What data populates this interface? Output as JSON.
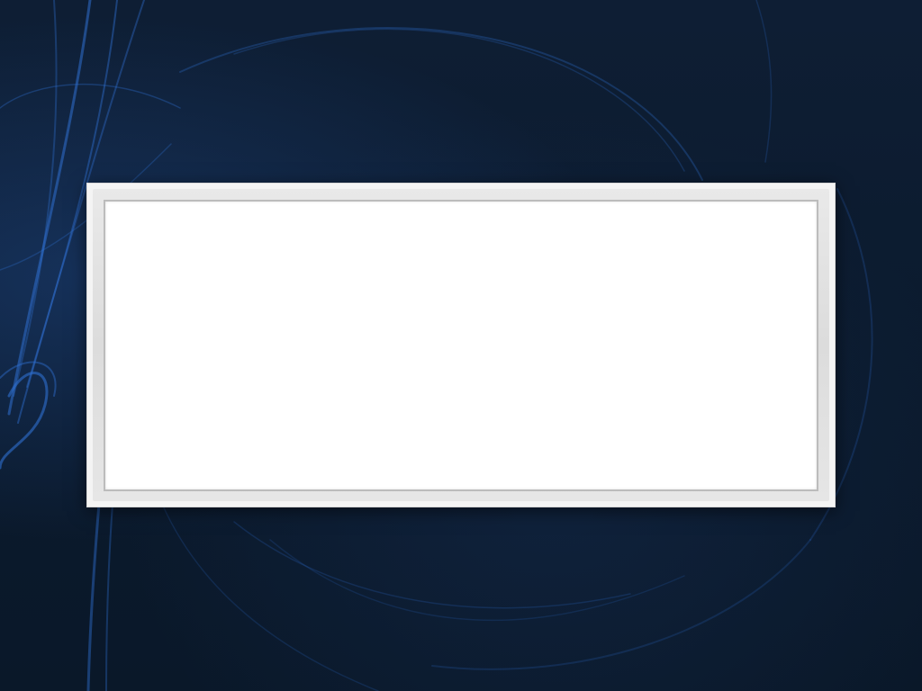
{
  "desktop": {
    "wallpaper_icon": "swirl-wallpaper",
    "background_color": "#0c1a2e",
    "accent_color": "#2f6fd0"
  },
  "dialog": {
    "frame_color": "#f4f4f4",
    "content_color": "#ffffff",
    "text": ""
  }
}
